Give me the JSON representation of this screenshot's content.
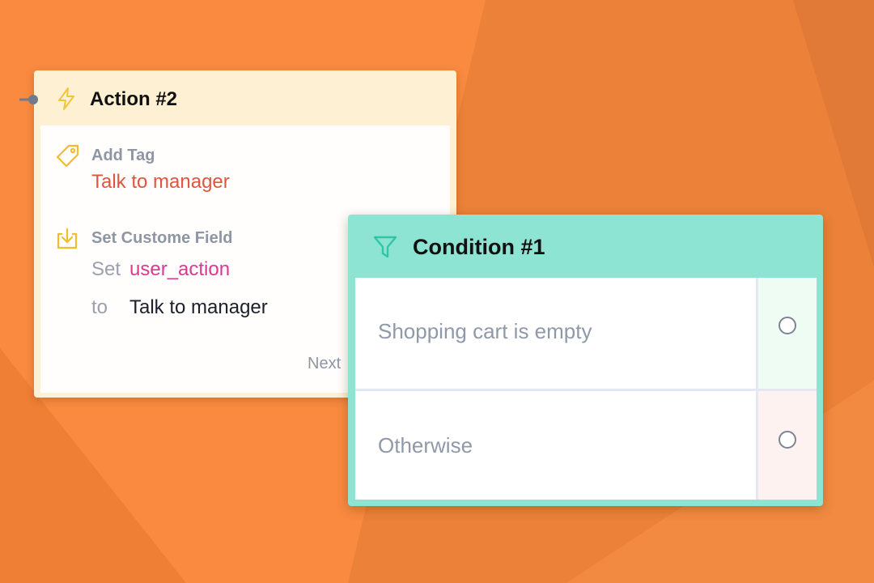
{
  "colors": {
    "background": "#f7893f",
    "action_header": "#fdf0d3",
    "condition_header": "#8ee4d3",
    "tag_value": "#e0553f",
    "variable": "#d93a91",
    "success_outlet": "#effcf4",
    "fail_outlet": "#fdf2ef"
  },
  "action": {
    "title": "Action #2",
    "icon": "lightning-bolt-icon",
    "steps": [
      {
        "icon": "tag-icon",
        "title": "Add Tag",
        "value": "Talk to manager"
      },
      {
        "icon": "download-icon",
        "title": "Set Custome Field",
        "set_word": "Set",
        "variable": "user_action",
        "to_word": "to",
        "value": "Talk to manager"
      }
    ],
    "next_label": "Next"
  },
  "condition": {
    "title": "Condition #1",
    "icon": "funnel-icon",
    "rows": [
      {
        "label": "Shopping cart is empty",
        "outlet": "success-outlet"
      },
      {
        "label": "Otherwise",
        "outlet": "fail-outlet"
      }
    ]
  }
}
